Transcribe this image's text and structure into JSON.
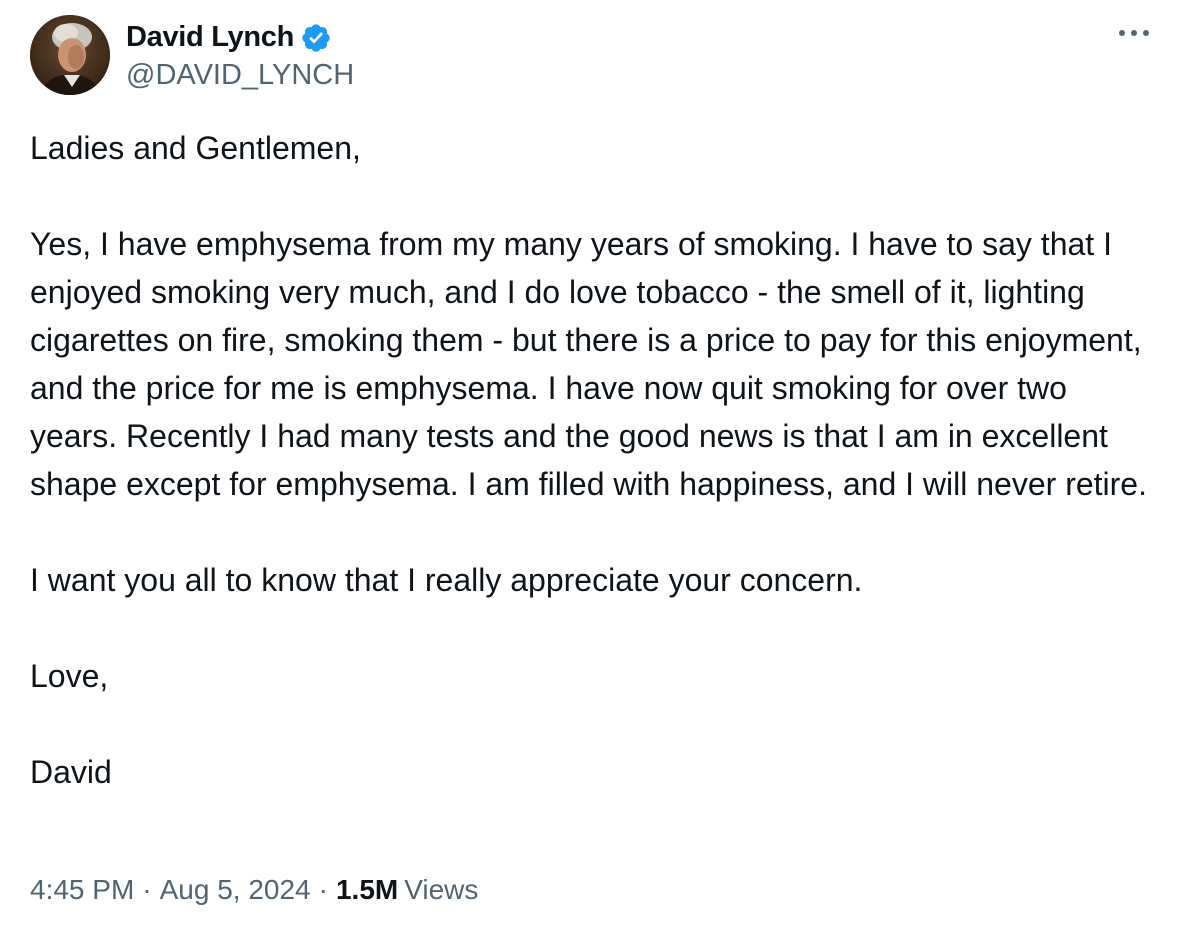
{
  "author": {
    "display_name": "David Lynch",
    "handle": "@DAVID_LYNCH",
    "verified": true,
    "avatar_icon": "profile-photo",
    "verified_icon": "verified-badge-icon"
  },
  "tweet": {
    "paragraphs": [
      "Ladies and Gentlemen,",
      "Yes, I have emphysema from my many years of smoking. I have to say that I enjoyed smoking very much, and I do love tobacco - the smell of it, lighting cigarettes on fire, smoking them - but there is a price to pay for this enjoyment, and the price for me is emphysema. I have now quit smoking for over two years. Recently I had many tests and the good news is that I am in excellent shape except for emphysema. I am filled with happiness, and I will never retire.",
      "I want you all to know that I really appreciate your concern.",
      "Love,",
      "David"
    ]
  },
  "meta": {
    "time": "4:45 PM",
    "separator": "·",
    "date": "Aug 5, 2024",
    "views_count": "1.5M",
    "views_label": "Views"
  },
  "menu": {
    "icon": "more-options-icon"
  },
  "colors": {
    "text": "#0f1419",
    "secondary": "#536471",
    "verified_blue": "#1d9bf0"
  }
}
